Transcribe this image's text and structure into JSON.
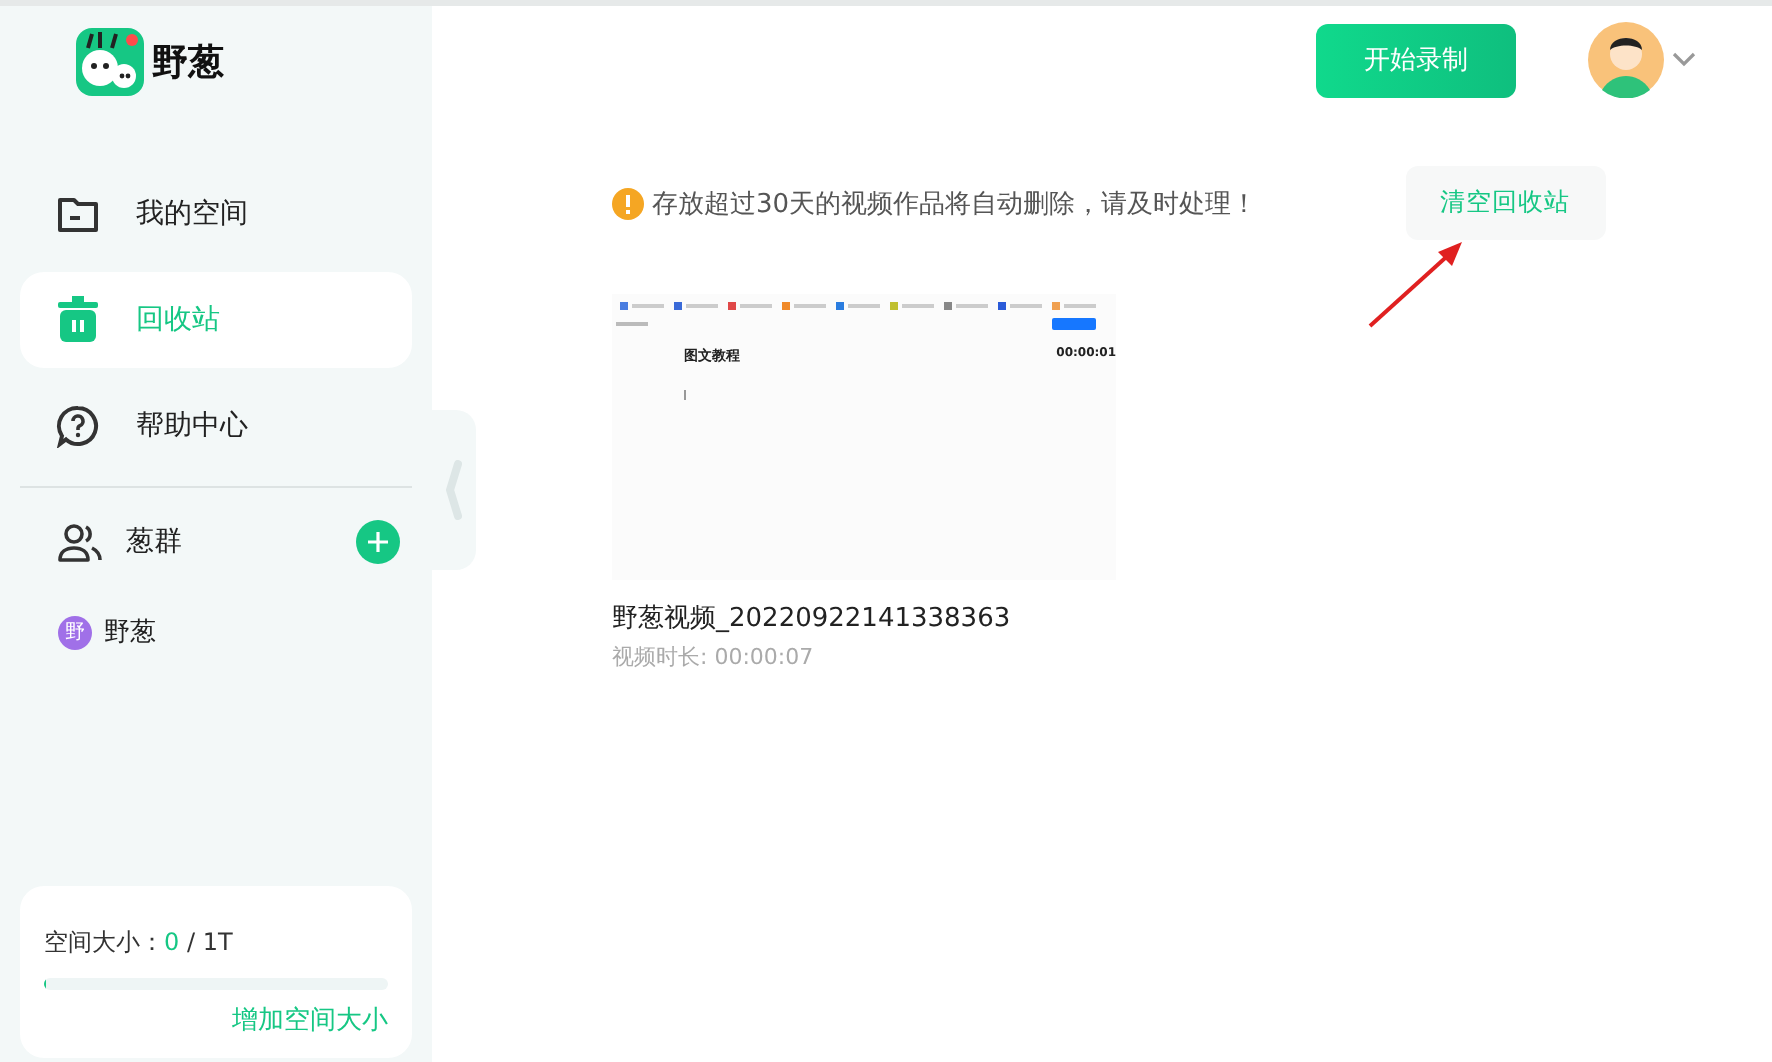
{
  "logo": {
    "name": "野葱"
  },
  "nav": [
    {
      "label": "我的空间",
      "kind": "folder",
      "selected": false
    },
    {
      "label": "回收站",
      "kind": "trash",
      "selected": true
    },
    {
      "label": "帮助中心",
      "kind": "help",
      "selected": false
    }
  ],
  "groups": {
    "label": "葱群",
    "items": [
      {
        "badge": "野",
        "name": "野葱",
        "color": "#a070e8"
      }
    ]
  },
  "storage": {
    "label": "空间大小：",
    "used": "0",
    "total": " / 1T",
    "level": 0.005,
    "action": "增加空间大小"
  },
  "header": {
    "record_button": "开始录制"
  },
  "notice": {
    "text": "存放超过30天的视频作品将自动删除，请及时处理！",
    "button": "清空回收站"
  },
  "videos": [
    {
      "title": "野葱视频_20220922141338363",
      "duration": "视频时长: 00:00:07",
      "thumb_heading": "图文教程",
      "thumb_time": "00:00:01"
    }
  ]
}
